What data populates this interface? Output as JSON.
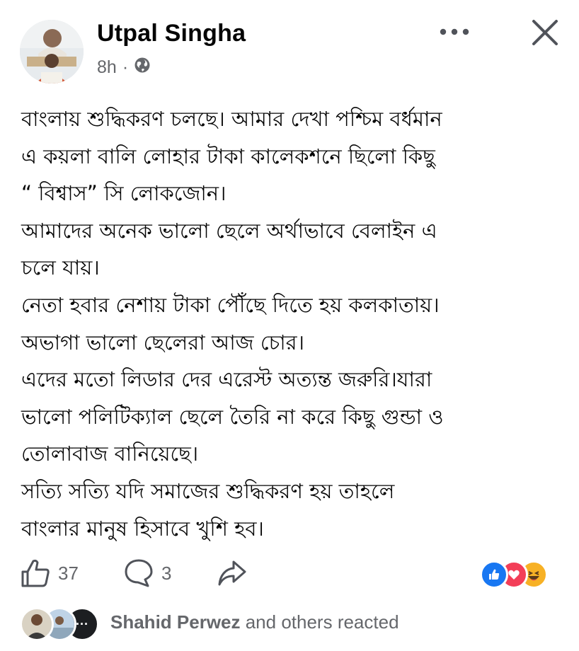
{
  "post": {
    "author": "Utpal Singha",
    "time": "8h",
    "separator": "·",
    "privacy_icon": "globe-icon",
    "body_lines": [
      "বাংলায় শুদ্ধিকরণ চলছে। আমার দেখা পশ্চিম বর্ধমান",
      "এ কয়লা বালি লোহার টাকা কালেকশনে ছিলো কিছু",
      "“ বিশ্বাস” সি লোকজোন।",
      "আমাদের অনেক ভালো ছেলে অর্থাভাবে বেলাইন এ",
      "চলে যায়।",
      "নেতা হবার নেশায় টাকা পৌঁছে দিতে হয় কলকাতায়।",
      "অভাগা ভালো ছেলেরা আজ চোর।",
      "এদের মতো লিডার দের এরেস্ট অত্যন্ত জরুরি।যারা",
      "ভালো পলিটিক্যাল ছেলে তৈরি না করে কিছু গুন্ডা ও",
      "তোলাবাজ বানিয়েছে।",
      "সত্যি সত্যি  যদি সমাজের শুদ্ধিকরণ হয় তাহলে",
      "বাংলার মানুষ হিসাবে খুশি হব।"
    ]
  },
  "actions": {
    "like_count": "37",
    "comment_count": "3",
    "like_icon": "thumbs-up-icon",
    "comment_icon": "comment-icon",
    "share_icon": "share-icon"
  },
  "reactions": {
    "types": [
      "like",
      "love",
      "haha"
    ],
    "colors": {
      "like": "#1877f2",
      "love": "#f33e58",
      "haha": "#f7b125"
    }
  },
  "reacted": {
    "name": "Shahid Perwez",
    "suffix": " and others reacted",
    "more_label": "···"
  },
  "colors": {
    "text": "#050505",
    "secondary": "#65676b",
    "background": "#ffffff"
  }
}
